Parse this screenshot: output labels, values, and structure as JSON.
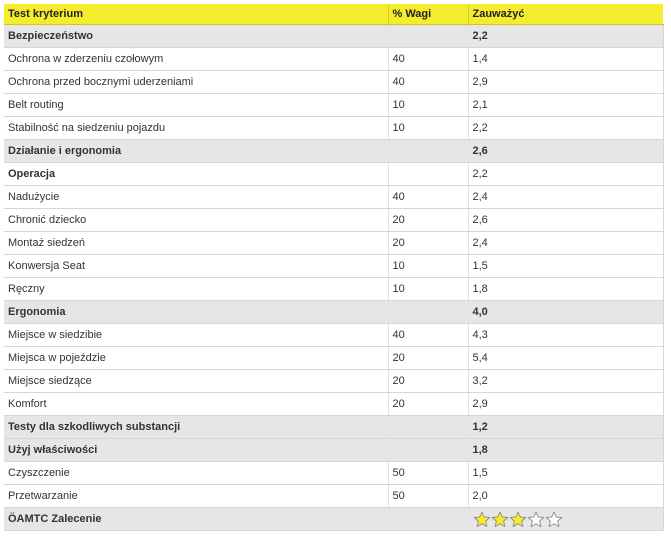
{
  "header": {
    "col1": "Test kryterium",
    "col2": "% Wagi",
    "col3": "Zauważyć"
  },
  "rows": [
    {
      "kind": "section",
      "label": "Bezpieczeństwo",
      "weight": "",
      "score": "2,2"
    },
    {
      "kind": "item",
      "label": "Ochrona w zderzeniu czołowym",
      "weight": "40",
      "score": "1,4"
    },
    {
      "kind": "item",
      "label": "Ochrona przed bocznymi uderzeniami",
      "weight": "40",
      "score": "2,9"
    },
    {
      "kind": "item",
      "label": "Belt routing",
      "weight": "10",
      "score": "2,1"
    },
    {
      "kind": "item",
      "label": "Stabilność na siedzeniu pojazdu",
      "weight": "10",
      "score": "2,2"
    },
    {
      "kind": "section",
      "label": "Działanie i ergonomia",
      "weight": "",
      "score": "2,6"
    },
    {
      "kind": "subsection",
      "label": "Operacja",
      "weight": "",
      "score": "2,2"
    },
    {
      "kind": "item",
      "label": "Nadużycie",
      "weight": "40",
      "score": "2,4"
    },
    {
      "kind": "item",
      "label": "Chronić dziecko",
      "weight": "20",
      "score": "2,6"
    },
    {
      "kind": "item",
      "label": "Montaż siedzeń",
      "weight": "20",
      "score": "2,4"
    },
    {
      "kind": "item",
      "label": "Konwersja Seat",
      "weight": "10",
      "score": "1,5"
    },
    {
      "kind": "item",
      "label": "Ręczny",
      "weight": "10",
      "score": "1,8"
    },
    {
      "kind": "section",
      "label": "Ergonomia",
      "weight": "",
      "score": "4,0"
    },
    {
      "kind": "item",
      "label": "Miejsce w siedzibie",
      "weight": "40",
      "score": "4,3"
    },
    {
      "kind": "item",
      "label": "Miejsca w pojeździe",
      "weight": "20",
      "score": "5,4"
    },
    {
      "kind": "item",
      "label": "Miejsce siedzące",
      "weight": "20",
      "score": "3,2"
    },
    {
      "kind": "item",
      "label": "Komfort",
      "weight": "20",
      "score": "2,9"
    },
    {
      "kind": "section",
      "label": "Testy dla szkodliwych substancji",
      "weight": "",
      "score": "1,2"
    },
    {
      "kind": "section",
      "label": "Użyj właściwości",
      "weight": "",
      "score": "1,8"
    },
    {
      "kind": "item",
      "label": "Czyszczenie",
      "weight": "50",
      "score": "1,5"
    },
    {
      "kind": "item",
      "label": "Przetwarzanie",
      "weight": "50",
      "score": "2,0"
    }
  ],
  "recommendation": {
    "label": "ÖAMTC Zalecenie",
    "stars_filled": 3,
    "stars_total": 5,
    "filled_color": "#f5ec2e",
    "empty_color": "#ffffff",
    "icon": "star-icon"
  },
  "colors": {
    "header_bg": "#f5ec2e",
    "section_bg": "#e6e6e6",
    "text": "#333333",
    "grid": "#d6d6d6"
  }
}
